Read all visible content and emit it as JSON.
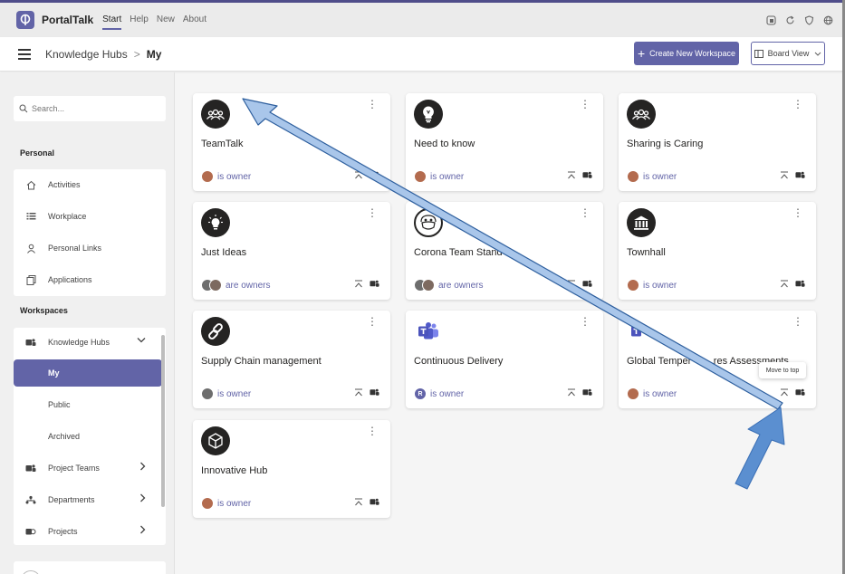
{
  "app": {
    "brand": "PortalTalk"
  },
  "topnav": [
    {
      "label": "Start",
      "active": true
    },
    {
      "label": "Help",
      "active": false
    },
    {
      "label": "New",
      "active": false
    },
    {
      "label": "About",
      "active": false
    }
  ],
  "breadcrumb": {
    "parent": "Knowledge Hubs",
    "separator": ">",
    "current": "My"
  },
  "toolbar": {
    "create_label": "Create New Workspace",
    "view_label": "Board View"
  },
  "search": {
    "placeholder": "Search..."
  },
  "sidebar": {
    "personal_label": "Personal",
    "personal_items": [
      "Activities",
      "Workplace",
      "Personal Links",
      "Applications"
    ],
    "workspaces_label": "Workspaces",
    "knowledge_hubs": "Knowledge Hubs",
    "sub_items": [
      "My",
      "Public",
      "Archived"
    ],
    "other_items": [
      "Project Teams",
      "Departments",
      "Projects"
    ]
  },
  "cards": [
    {
      "title": "TeamTalk",
      "owner": "is owner"
    },
    {
      "title": "Need to know",
      "owner": "is owner"
    },
    {
      "title": "Sharing is Caring",
      "owner": "is owner"
    },
    {
      "title": "Just Ideas",
      "owner": "are owners"
    },
    {
      "title": "Corona Team Stand",
      "owner": "are owners"
    },
    {
      "title": "Townhall",
      "owner": "is owner"
    },
    {
      "title": "Supply Chain management",
      "owner": "is owner"
    },
    {
      "title": "Continuous Delivery",
      "owner": "is owner"
    },
    {
      "title": "Global Temper        res Assessments",
      "owner": "is owner"
    },
    {
      "title": "Innovative Hub",
      "owner": "is owner"
    }
  ],
  "tooltip": "Move to top",
  "colors": {
    "accent": "#6264a7",
    "arrow_fill": "#a9c6ea",
    "arrow_stroke": "#2e5f9e",
    "arrow_solid": "#5b8fd0"
  }
}
